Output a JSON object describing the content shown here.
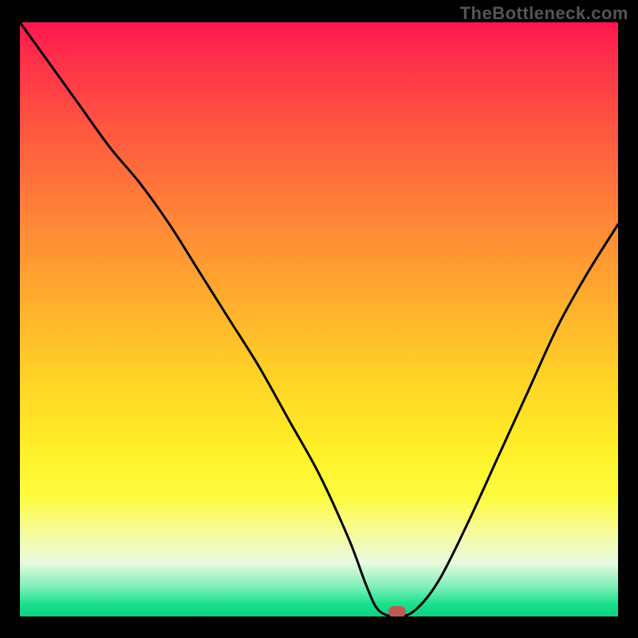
{
  "watermark": "TheBottleneck.com",
  "colors": {
    "background": "#000000",
    "curve": "#000000",
    "marker": "#c15a52",
    "gradient_top": "#ff1650",
    "gradient_bottom": "#0fd184"
  },
  "chart_data": {
    "type": "line",
    "title": "",
    "xlabel": "",
    "ylabel": "",
    "xlim": [
      0,
      100
    ],
    "ylim": [
      0,
      100
    ],
    "grid": false,
    "legend": false,
    "x": [
      0,
      5,
      10,
      15,
      20,
      25,
      30,
      35,
      40,
      45,
      50,
      55,
      58,
      60,
      63,
      66,
      70,
      75,
      80,
      85,
      90,
      95,
      100
    ],
    "values": [
      100,
      93,
      86,
      79,
      73,
      66,
      58,
      50,
      42,
      33,
      24,
      13,
      5,
      1,
      0,
      1,
      6,
      16,
      27,
      38,
      49,
      58,
      66
    ],
    "min_point": {
      "x": 63,
      "y": 0
    },
    "notes": "V-shaped bottleneck curve over vertical red-to-green heatmap gradient; minimum near x≈63%"
  }
}
